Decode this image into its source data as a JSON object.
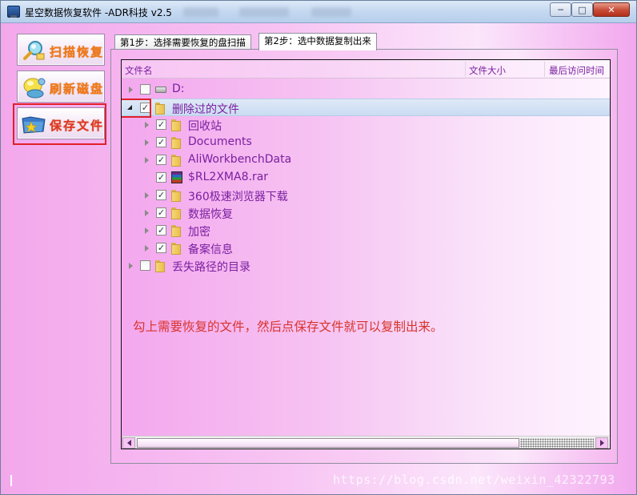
{
  "window": {
    "title": "星空数据恢复软件   -ADR科技 v2.5",
    "controls": {
      "minimize": "─",
      "maximize": "□",
      "close": "✕"
    }
  },
  "sidebar": {
    "buttons": [
      {
        "label": "扫描恢复",
        "icon": "magnifier-scan-icon"
      },
      {
        "label": "刷新磁盘",
        "icon": "refresh-bulb-icon"
      },
      {
        "label": "保存文件",
        "icon": "save-folder-icon"
      }
    ]
  },
  "tabs": [
    {
      "label": "第1步：选择需要恢复的盘扫描"
    },
    {
      "label": "第2步：选中数据复制出来"
    }
  ],
  "tree": {
    "columns": {
      "name": "文件名",
      "size": "文件大小",
      "last_access": "最后访问时间"
    },
    "nodes": [
      {
        "label": "D:",
        "checked": false,
        "type": "drive",
        "expandable": true,
        "expanded": false
      },
      {
        "label": "删除过的文件",
        "checked": true,
        "type": "folder",
        "expandable": true,
        "expanded": true
      },
      {
        "label": "回收站",
        "checked": true,
        "type": "folder",
        "expandable": true,
        "expanded": false
      },
      {
        "label": "Documents",
        "checked": true,
        "type": "folder",
        "expandable": true,
        "expanded": false
      },
      {
        "label": "AliWorkbenchData",
        "checked": true,
        "type": "folder",
        "expandable": true,
        "expanded": false
      },
      {
        "label": "$RL2XMA8.rar",
        "checked": true,
        "type": "rar",
        "expandable": false,
        "expanded": false
      },
      {
        "label": "360极速浏览器下载",
        "checked": true,
        "type": "folder",
        "expandable": true,
        "expanded": false
      },
      {
        "label": "数据恢复",
        "checked": true,
        "type": "folder",
        "expandable": true,
        "expanded": false
      },
      {
        "label": "加密",
        "checked": true,
        "type": "folder",
        "expandable": true,
        "expanded": false
      },
      {
        "label": "备案信息",
        "checked": true,
        "type": "folder",
        "expandable": true,
        "expanded": false
      },
      {
        "label": "丢失路径的目录",
        "checked": false,
        "type": "folder",
        "expandable": true,
        "expanded": false
      }
    ]
  },
  "hint": "勾上需要恢复的文件，然后点保存文件就可以复制出来。",
  "watermark": "https://blog.csdn.net/weixin_42322793",
  "colors": {
    "label_text": "#7a1fa0",
    "hint_text": "#d8342c",
    "highlight": "#e0202a",
    "button_text": "#f07a1a"
  }
}
